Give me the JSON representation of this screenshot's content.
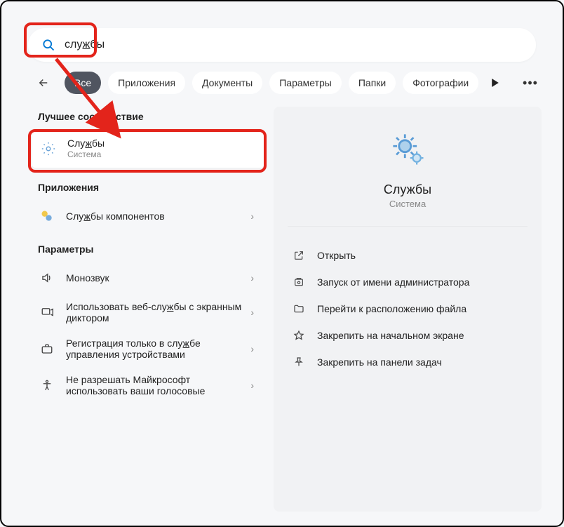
{
  "search": {
    "value": "службы",
    "value_html": "слу<span class=\"u\">ж</span>бы"
  },
  "filters": {
    "all": "Все",
    "apps": "Приложения",
    "docs": "Документы",
    "settings": "Параметры",
    "folders": "Папки",
    "photos": "Фотографии"
  },
  "sections": {
    "best_match": "Лучшее соответствие",
    "apps": "Приложения",
    "settings": "Параметры"
  },
  "best": {
    "title": "Службы",
    "title_html": "Слу<span class=\"u\">ж</span>бы",
    "subtitle": "Система"
  },
  "apps": [
    {
      "title": "Службы компонентов",
      "title_html": "Слу<span class=\"u\">ж</span>бы компонентов"
    }
  ],
  "settings": [
    {
      "title": "Монозвук"
    },
    {
      "title": "Использовать веб-службы с экранным диктором",
      "title_html": "Использовать веб-слу<span class=\"u\">ж</span>бы с экранным диктором"
    },
    {
      "title": "Регистрация только в службе управления устройствами",
      "title_html": "Регистрация только в слу<span class=\"u\">ж</span>бе управления устройствами"
    },
    {
      "title": "Не разрешать Майкрософт использовать ваши голосовые"
    }
  ],
  "detail": {
    "title": "Службы",
    "subtitle": "Система",
    "actions": {
      "open": "Открыть",
      "run_admin": "Запуск от имени администратора",
      "goto_file": "Перейти к расположению файла",
      "pin_start": "Закрепить на начальном экране",
      "pin_taskbar": "Закрепить на панели задач"
    }
  }
}
